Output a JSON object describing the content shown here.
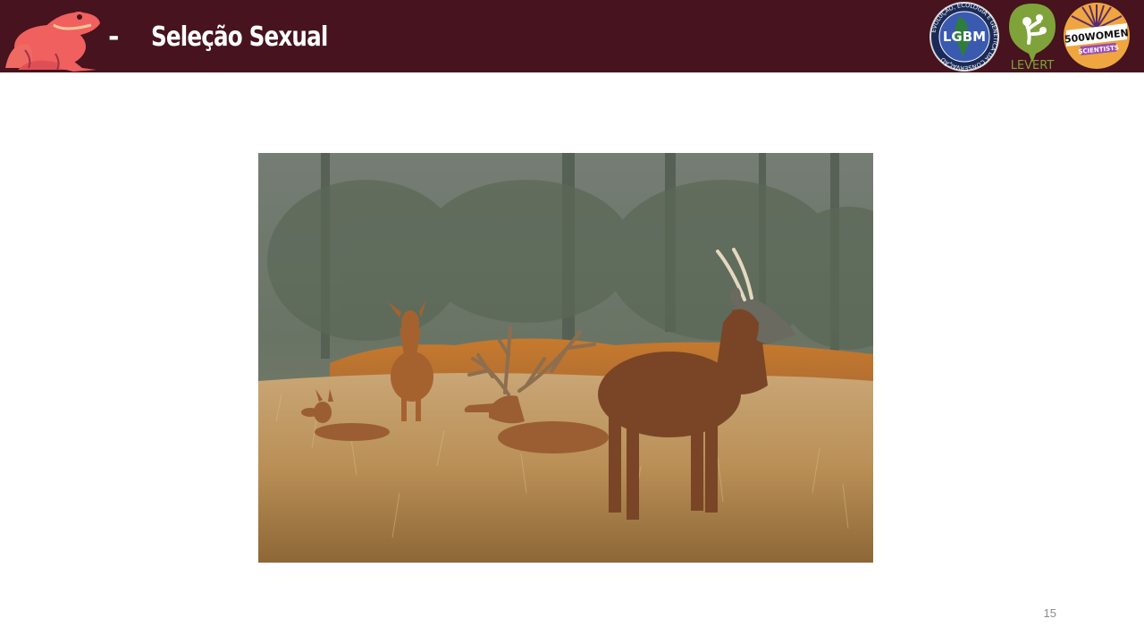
{
  "header": {
    "dash": "-",
    "title": "Seleção Sexual",
    "background_color": "#46131e",
    "frog_logo_color": "#f0605e",
    "logos": {
      "lgbm": {
        "text": "LGBM",
        "ring_text": "EVOLUÇÃO, ECOLOGIA E GENÉTICA DA CONSERVAÇÃO"
      },
      "levert": {
        "text": "LEVERT",
        "color": "#7fa33a"
      },
      "women_scientists": {
        "line1": "500WOMEN",
        "line2": "SCIENTISTS",
        "color": "#efa640"
      }
    }
  },
  "photo": {
    "subject": "red deer herd with stags and hinds in tall golden grass before a misty forest"
  },
  "footer": {
    "page_number": "15"
  }
}
